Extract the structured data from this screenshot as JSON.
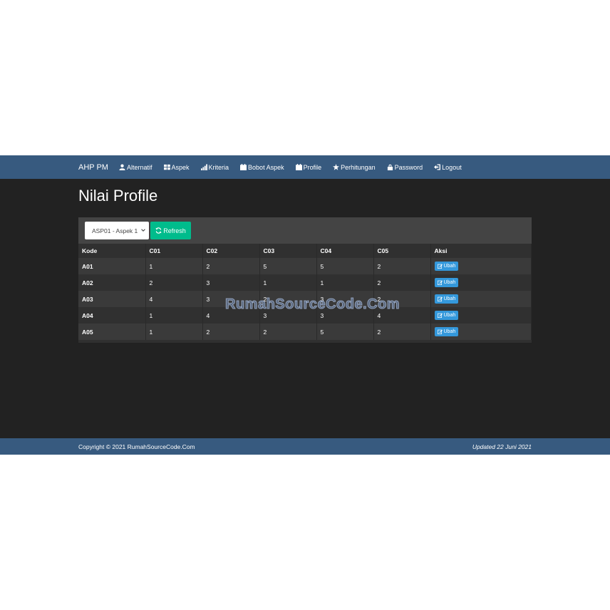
{
  "navbar": {
    "brand": "AHP PM",
    "items": [
      {
        "label": "Alternatif",
        "icon": "user-icon"
      },
      {
        "label": "Aspek",
        "icon": "grid-icon"
      },
      {
        "label": "Kriteria",
        "icon": "signal-icon"
      },
      {
        "label": "Bobot Aspek",
        "icon": "calendar-icon"
      },
      {
        "label": "Profile",
        "icon": "calendar-icon"
      },
      {
        "label": "Perhitungan",
        "icon": "star-icon"
      },
      {
        "label": "Password",
        "icon": "lock-icon"
      },
      {
        "label": "Logout",
        "icon": "logout-icon"
      }
    ]
  },
  "page": {
    "title": "Nilai Profile"
  },
  "filter": {
    "selected": "ASP01 - Aspek 1",
    "refresh_label": "Refresh"
  },
  "table": {
    "headers": [
      "Kode",
      "C01",
      "C02",
      "C03",
      "C04",
      "C05",
      "Aksi"
    ],
    "rows": [
      {
        "code": "A01",
        "values": [
          "1",
          "2",
          "5",
          "5",
          "2"
        ]
      },
      {
        "code": "A02",
        "values": [
          "2",
          "3",
          "1",
          "1",
          "2"
        ]
      },
      {
        "code": "A03",
        "values": [
          "4",
          "3",
          "2",
          "3",
          "2"
        ]
      },
      {
        "code": "A04",
        "values": [
          "1",
          "4",
          "3",
          "3",
          "4"
        ]
      },
      {
        "code": "A05",
        "values": [
          "1",
          "2",
          "2",
          "5",
          "2"
        ]
      }
    ],
    "action_label": "Ubah"
  },
  "watermark": "RumahSourceCode.Com",
  "footer": {
    "copyright": "Copyright © 2021 RumahSourceCode.Com",
    "updated": "Updated 22 Juni 2021"
  },
  "colors": {
    "navbar": "#375a7f",
    "background": "#222222",
    "success": "#00bc8c",
    "info": "#3498db"
  }
}
